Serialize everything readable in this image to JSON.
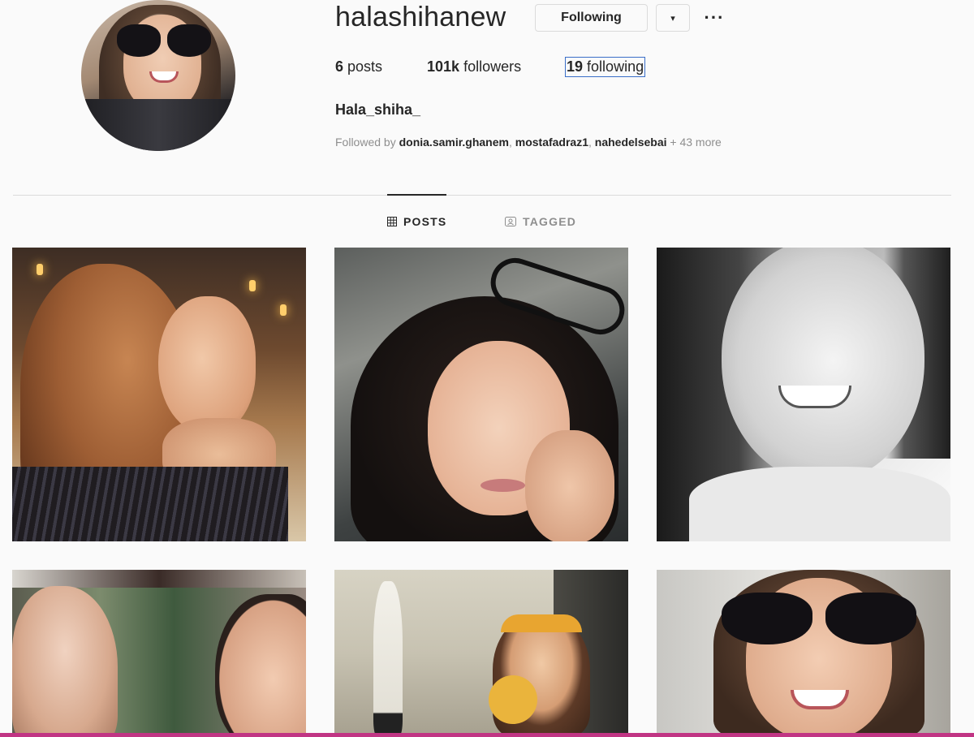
{
  "profile": {
    "username": "halashihanew",
    "following_button": "Following",
    "dropdown_glyph": "▾",
    "more_glyph": "···",
    "stats": {
      "posts_count": "6",
      "posts_label": "posts",
      "followers_count": "101k",
      "followers_label": "followers",
      "following_count": "19",
      "following_label": "following"
    },
    "full_name": "Hala_shiha_",
    "followed_by": {
      "prefix": "Followed by",
      "users": [
        "donia.samir.ghanem",
        "mostafadraz1",
        "nahedelsebai"
      ],
      "more": "+ 43 more"
    }
  },
  "tabs": [
    {
      "label": "POSTS",
      "icon": "grid-icon",
      "active": true
    },
    {
      "label": "TAGGED",
      "icon": "tagged-icon",
      "active": false
    }
  ],
  "posts": [
    {
      "alt": "woman-in-cafe"
    },
    {
      "alt": "woman-with-sunglasses-on-head"
    },
    {
      "alt": "black-and-white-smile"
    },
    {
      "alt": "couple-closeup"
    },
    {
      "alt": "girl-with-headband-street"
    },
    {
      "alt": "selfie-sunglasses-car"
    }
  ],
  "colors": {
    "background": "#fafafa",
    "text": "#262626",
    "muted": "#8e8e8e",
    "border": "#dbdbdb",
    "focus_outline": "#3a6ec8",
    "accent": "#c13584"
  }
}
